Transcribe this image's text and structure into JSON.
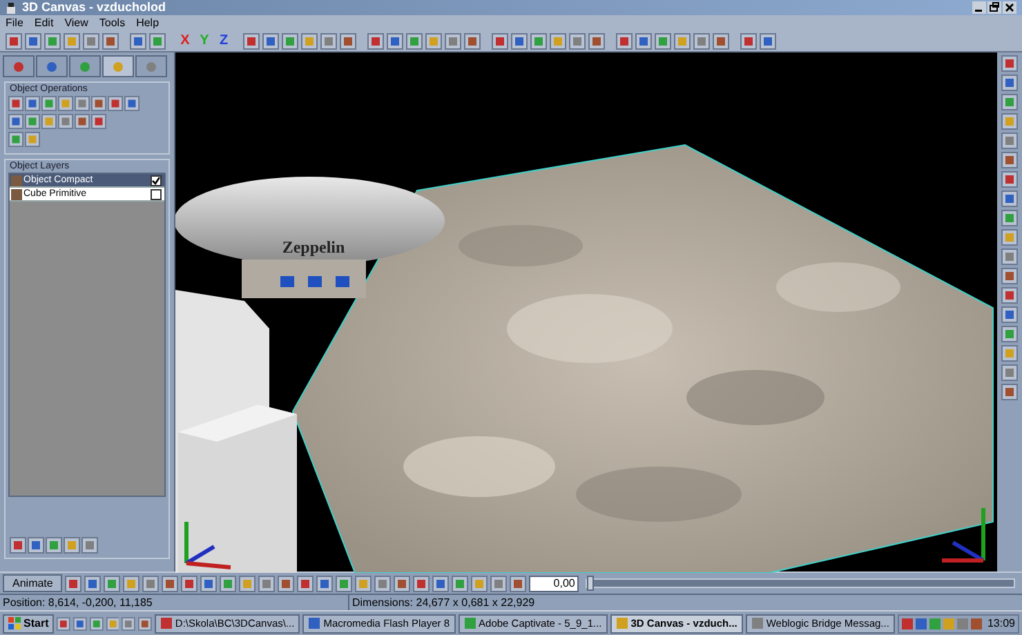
{
  "window": {
    "title": "3D Canvas - vzducholod"
  },
  "menu": [
    "File",
    "Edit",
    "View",
    "Tools",
    "Help"
  ],
  "toolbar": {
    "axes": [
      {
        "label": "X",
        "color": "#e02020"
      },
      {
        "label": "Y",
        "color": "#20b020"
      },
      {
        "label": "Z",
        "color": "#2040e0"
      }
    ]
  },
  "panel": {
    "tabs": [
      {
        "selected": false
      },
      {
        "selected": false
      },
      {
        "selected": false
      },
      {
        "selected": true
      },
      {
        "selected": false
      }
    ],
    "operations_title": "Object Operations",
    "layers_title": "Object Layers",
    "layers": [
      {
        "label": "Object Compact",
        "selected": true,
        "checked": true
      },
      {
        "label": "Cube Primitive",
        "selected": false,
        "checked": false
      }
    ]
  },
  "viewport": {
    "model_label": "Zeppelin"
  },
  "animation": {
    "button": "Animate",
    "frame": "0,00",
    "level": 0
  },
  "status": {
    "position": "Position: 8,614, -0,200, 11,185",
    "dimensions": "Dimensions: 24,677 x 0,681 x 22,929"
  },
  "taskbar": {
    "start": "Start",
    "tasks": [
      {
        "label": "D:\\Skola\\BC\\3DCanvas\\...",
        "selected": false
      },
      {
        "label": "Macromedia Flash Player 8",
        "selected": false
      },
      {
        "label": "Adobe Captivate - 5_9_1...",
        "selected": false
      },
      {
        "label": "3D Canvas - vzduch...",
        "selected": true
      },
      {
        "label": "Weblogic Bridge Messag...",
        "selected": false
      }
    ],
    "clock": "13:09"
  }
}
